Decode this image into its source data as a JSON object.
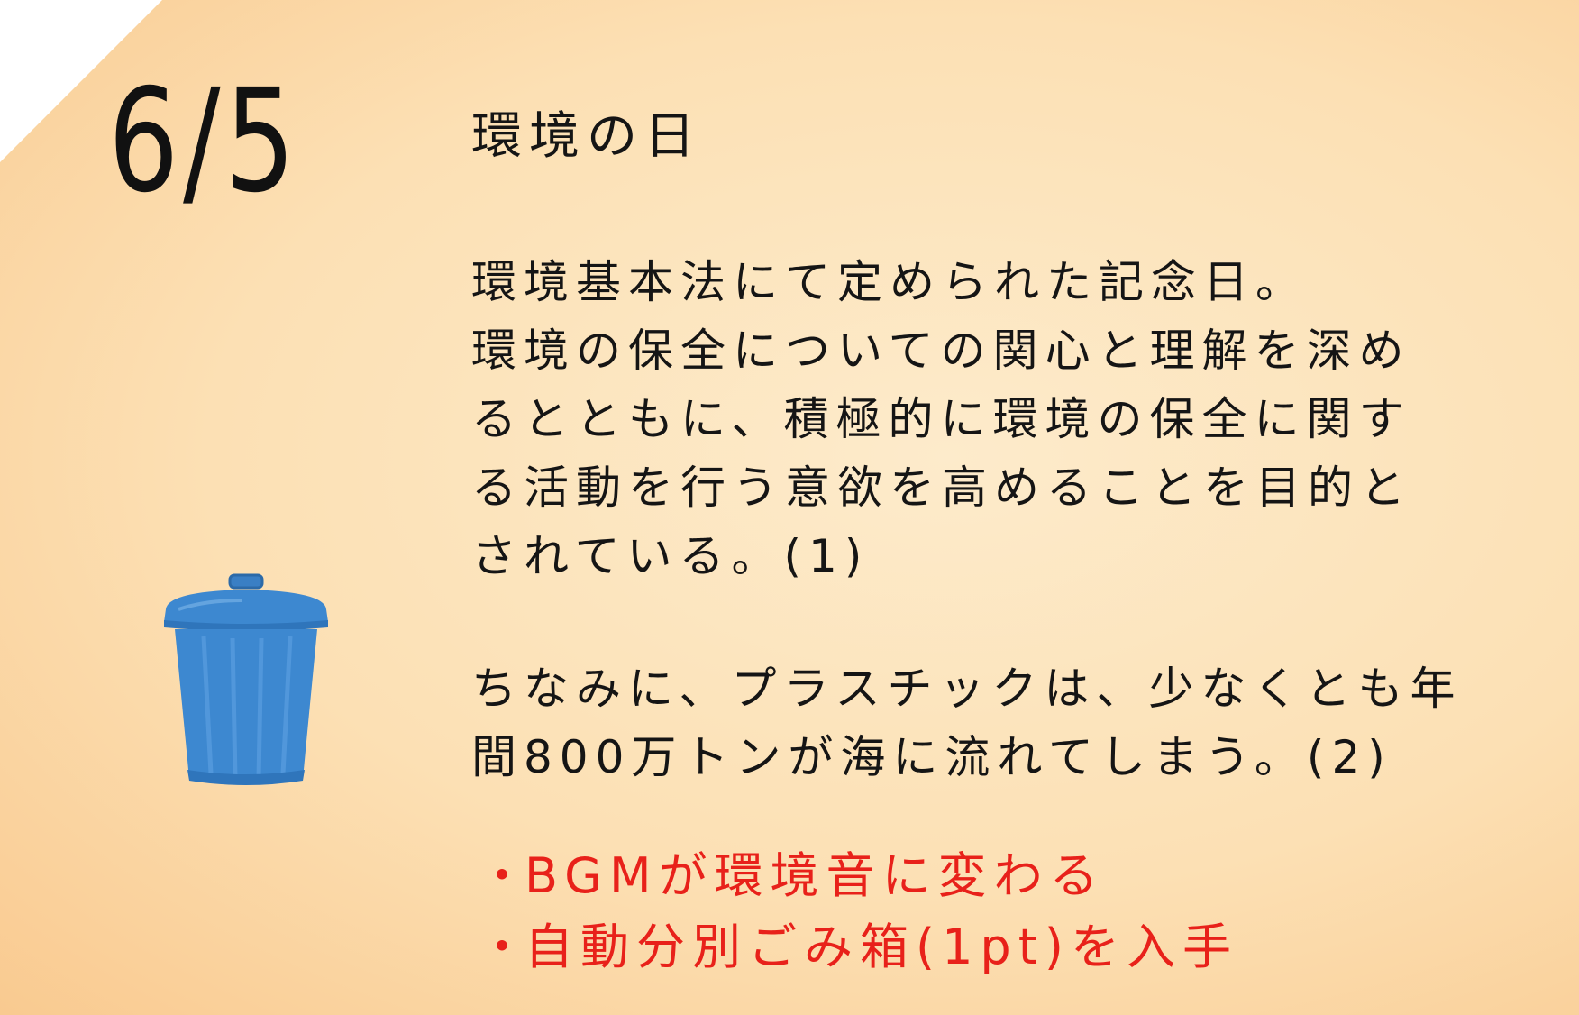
{
  "date": "6/5",
  "title": "環境の日",
  "paragraph1": [
    "環境基本法にて定められた記念日。",
    "環境の保全についての関心と理解を深め",
    "るとともに、積極的に環境の保全に関す",
    "る活動を行う意欲を高めることを目的と",
    "されている。(1)"
  ],
  "paragraph2": [
    "ちなみに、プラスチックは、少なくとも年",
    "間800万トンが海に流れてしまう。(2)"
  ],
  "bullets": [
    {
      "dot": "・",
      "text": "BGMが環境音に変わる"
    },
    {
      "dot": "・",
      "text": "自動分別ごみ箱(1pt)を入手"
    }
  ],
  "colors": {
    "text": "#151515",
    "accent": "#e8211a",
    "trash_can": "#3d88d0"
  },
  "icon": "trash-can-icon"
}
